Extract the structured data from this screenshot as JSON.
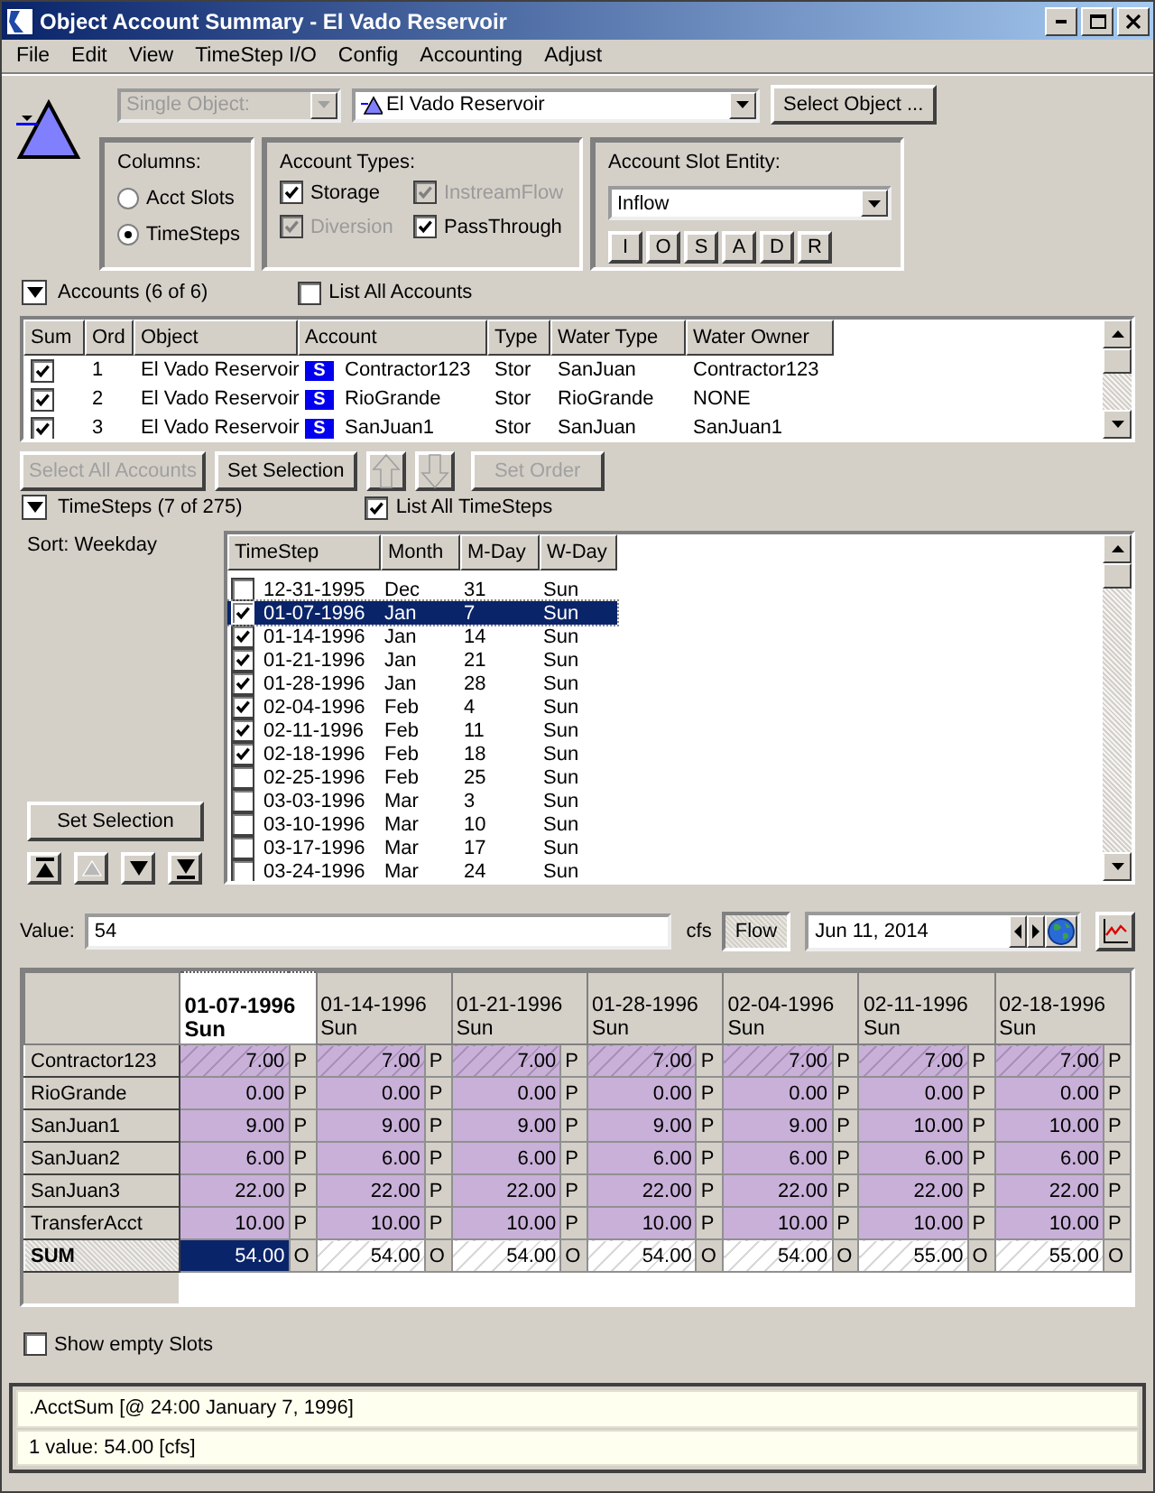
{
  "window": {
    "title": "Object Account Summary - El Vado Reservoir"
  },
  "menu": [
    "File",
    "Edit",
    "View",
    "TimeStep I/O",
    "Config",
    "Accounting",
    "Adjust"
  ],
  "object_bar": {
    "mode": {
      "value": "Single Object:",
      "disabled": true
    },
    "object": {
      "value": "El Vado Reservoir"
    },
    "select_button": "Select Object ..."
  },
  "columns_group": {
    "title": "Columns:",
    "options": [
      {
        "label": "Acct Slots",
        "selected": false
      },
      {
        "label": "TimeSteps",
        "selected": true
      }
    ]
  },
  "account_types": {
    "title": "Account Types:",
    "options": [
      {
        "label": "Storage",
        "checked": true,
        "disabled": false
      },
      {
        "label": "InstreamFlow",
        "checked": true,
        "disabled": true
      },
      {
        "label": "Diversion",
        "checked": true,
        "disabled": true
      },
      {
        "label": "PassThrough",
        "checked": true,
        "disabled": false
      }
    ]
  },
  "slot_entity": {
    "title": "Account Slot Entity:",
    "value": "Inflow",
    "buttons": [
      "I",
      "O",
      "S",
      "A",
      "D",
      "R"
    ]
  },
  "accounts": {
    "expanded": true,
    "title": "Accounts (6 of 6)",
    "list_all": {
      "label": "List All Accounts",
      "checked": false
    },
    "columns": [
      "Sum",
      "Ord",
      "Object",
      "Account",
      "Type",
      "Water Type",
      "Water Owner"
    ],
    "rows": [
      {
        "sum": true,
        "ord": "1",
        "object": "El Vado Reservoir",
        "badge": "S",
        "account": "Contractor123",
        "type": "Stor",
        "water_type": "SanJuan",
        "water_owner": "Contractor123"
      },
      {
        "sum": true,
        "ord": "2",
        "object": "El Vado Reservoir",
        "badge": "S",
        "account": "RioGrande",
        "type": "Stor",
        "water_type": "RioGrande",
        "water_owner": "NONE"
      },
      {
        "sum": true,
        "ord": "3",
        "object": "El Vado Reservoir",
        "badge": "S",
        "account": "SanJuan1",
        "type": "Stor",
        "water_type": "SanJuan",
        "water_owner": "SanJuan1"
      }
    ],
    "buttons": [
      {
        "kind": "text",
        "label": "Select All Accounts",
        "disabled": true
      },
      {
        "kind": "text",
        "label": "Set Selection",
        "disabled": false
      },
      {
        "kind": "up",
        "disabled": true
      },
      {
        "kind": "down",
        "disabled": true
      },
      {
        "kind": "text",
        "label": "Set Order",
        "disabled": true
      }
    ]
  },
  "timesteps": {
    "expanded": true,
    "title": "TimeSteps (7 of 275)",
    "list_all": {
      "label": "List All TimeSteps",
      "checked": true
    },
    "sort": "Sort: Weekday",
    "set_selection": "Set Selection",
    "nav_buttons": [
      {
        "kind": "first",
        "disabled": false
      },
      {
        "kind": "up",
        "disabled": true
      },
      {
        "kind": "down",
        "disabled": false
      },
      {
        "kind": "last",
        "disabled": false
      }
    ],
    "columns": [
      "TimeStep",
      "Month",
      "M-Day",
      "W-Day"
    ],
    "rows": [
      {
        "checked": false,
        "selected": false,
        "timestep": "12-31-1995",
        "month": "Dec",
        "mday": "31",
        "wday": "Sun"
      },
      {
        "checked": true,
        "selected": true,
        "timestep": "01-07-1996",
        "month": "Jan",
        "mday": "7",
        "wday": "Sun"
      },
      {
        "checked": true,
        "selected": false,
        "timestep": "01-14-1996",
        "month": "Jan",
        "mday": "14",
        "wday": "Sun"
      },
      {
        "checked": true,
        "selected": false,
        "timestep": "01-21-1996",
        "month": "Jan",
        "mday": "21",
        "wday": "Sun"
      },
      {
        "checked": true,
        "selected": false,
        "timestep": "01-28-1996",
        "month": "Jan",
        "mday": "28",
        "wday": "Sun"
      },
      {
        "checked": true,
        "selected": false,
        "timestep": "02-04-1996",
        "month": "Feb",
        "mday": "4",
        "wday": "Sun"
      },
      {
        "checked": true,
        "selected": false,
        "timestep": "02-11-1996",
        "month": "Feb",
        "mday": "11",
        "wday": "Sun"
      },
      {
        "checked": true,
        "selected": false,
        "timestep": "02-18-1996",
        "month": "Feb",
        "mday": "18",
        "wday": "Sun"
      },
      {
        "checked": false,
        "selected": false,
        "timestep": "02-25-1996",
        "month": "Feb",
        "mday": "25",
        "wday": "Sun"
      },
      {
        "checked": false,
        "selected": false,
        "timestep": "03-03-1996",
        "month": "Mar",
        "mday": "3",
        "wday": "Sun"
      },
      {
        "checked": false,
        "selected": false,
        "timestep": "03-10-1996",
        "month": "Mar",
        "mday": "10",
        "wday": "Sun"
      },
      {
        "checked": false,
        "selected": false,
        "timestep": "03-17-1996",
        "month": "Mar",
        "mday": "17",
        "wday": "Sun"
      },
      {
        "checked": false,
        "selected": false,
        "timestep": "03-24-1996",
        "month": "Mar",
        "mday": "24",
        "wday": "Sun"
      }
    ]
  },
  "value_bar": {
    "label": "Value:",
    "value": "54",
    "unit": "cfs",
    "flow_button": "Flow",
    "date": "Jun 11, 2014"
  },
  "grid": {
    "columns": [
      {
        "date": "01-07-1996",
        "day": "Sun",
        "selected": true
      },
      {
        "date": "01-14-1996",
        "day": "Sun",
        "selected": false
      },
      {
        "date": "01-21-1996",
        "day": "Sun",
        "selected": false
      },
      {
        "date": "01-28-1996",
        "day": "Sun",
        "selected": false
      },
      {
        "date": "02-04-1996",
        "day": "Sun",
        "selected": false
      },
      {
        "date": "02-11-1996",
        "day": "Sun",
        "selected": false
      },
      {
        "date": "02-18-1996",
        "day": "Sun",
        "selected": false
      }
    ],
    "rows": [
      {
        "kind": "account",
        "name": "Contractor123",
        "hatched": true,
        "cells": [
          {
            "value": "7.00",
            "flag": "P",
            "selected": false
          },
          {
            "value": "7.00",
            "flag": "P",
            "selected": false
          },
          {
            "value": "7.00",
            "flag": "P",
            "selected": false
          },
          {
            "value": "7.00",
            "flag": "P",
            "selected": false
          },
          {
            "value": "7.00",
            "flag": "P",
            "selected": false
          },
          {
            "value": "7.00",
            "flag": "P",
            "selected": false
          },
          {
            "value": "7.00",
            "flag": "P",
            "selected": false
          }
        ]
      },
      {
        "kind": "account",
        "name": "RioGrande",
        "hatched": false,
        "cells": [
          {
            "value": "0.00",
            "flag": "P",
            "selected": false
          },
          {
            "value": "0.00",
            "flag": "P",
            "selected": false
          },
          {
            "value": "0.00",
            "flag": "P",
            "selected": false
          },
          {
            "value": "0.00",
            "flag": "P",
            "selected": false
          },
          {
            "value": "0.00",
            "flag": "P",
            "selected": false
          },
          {
            "value": "0.00",
            "flag": "P",
            "selected": false
          },
          {
            "value": "0.00",
            "flag": "P",
            "selected": false
          }
        ]
      },
      {
        "kind": "account",
        "name": "SanJuan1",
        "hatched": false,
        "cells": [
          {
            "value": "9.00",
            "flag": "P",
            "selected": false
          },
          {
            "value": "9.00",
            "flag": "P",
            "selected": false
          },
          {
            "value": "9.00",
            "flag": "P",
            "selected": false
          },
          {
            "value": "9.00",
            "flag": "P",
            "selected": false
          },
          {
            "value": "9.00",
            "flag": "P",
            "selected": false
          },
          {
            "value": "10.00",
            "flag": "P",
            "selected": false
          },
          {
            "value": "10.00",
            "flag": "P",
            "selected": false
          }
        ]
      },
      {
        "kind": "account",
        "name": "SanJuan2",
        "hatched": false,
        "cells": [
          {
            "value": "6.00",
            "flag": "P",
            "selected": false
          },
          {
            "value": "6.00",
            "flag": "P",
            "selected": false
          },
          {
            "value": "6.00",
            "flag": "P",
            "selected": false
          },
          {
            "value": "6.00",
            "flag": "P",
            "selected": false
          },
          {
            "value": "6.00",
            "flag": "P",
            "selected": false
          },
          {
            "value": "6.00",
            "flag": "P",
            "selected": false
          },
          {
            "value": "6.00",
            "flag": "P",
            "selected": false
          }
        ]
      },
      {
        "kind": "account",
        "name": "SanJuan3",
        "hatched": false,
        "cells": [
          {
            "value": "22.00",
            "flag": "P",
            "selected": false
          },
          {
            "value": "22.00",
            "flag": "P",
            "selected": false
          },
          {
            "value": "22.00",
            "flag": "P",
            "selected": false
          },
          {
            "value": "22.00",
            "flag": "P",
            "selected": false
          },
          {
            "value": "22.00",
            "flag": "P",
            "selected": false
          },
          {
            "value": "22.00",
            "flag": "P",
            "selected": false
          },
          {
            "value": "22.00",
            "flag": "P",
            "selected": false
          }
        ]
      },
      {
        "kind": "account",
        "name": "TransferAcct",
        "hatched": false,
        "cells": [
          {
            "value": "10.00",
            "flag": "P",
            "selected": false
          },
          {
            "value": "10.00",
            "flag": "P",
            "selected": false
          },
          {
            "value": "10.00",
            "flag": "P",
            "selected": false
          },
          {
            "value": "10.00",
            "flag": "P",
            "selected": false
          },
          {
            "value": "10.00",
            "flag": "P",
            "selected": false
          },
          {
            "value": "10.00",
            "flag": "P",
            "selected": false
          },
          {
            "value": "10.00",
            "flag": "P",
            "selected": false
          }
        ]
      },
      {
        "kind": "sum",
        "name": "SUM",
        "hatched": true,
        "cells": [
          {
            "value": "54.00",
            "flag": "O",
            "selected": true
          },
          {
            "value": "54.00",
            "flag": "O",
            "selected": false
          },
          {
            "value": "54.00",
            "flag": "O",
            "selected": false
          },
          {
            "value": "54.00",
            "flag": "O",
            "selected": false
          },
          {
            "value": "54.00",
            "flag": "O",
            "selected": false
          },
          {
            "value": "55.00",
            "flag": "O",
            "selected": false
          },
          {
            "value": "55.00",
            "flag": "O",
            "selected": false
          }
        ]
      }
    ]
  },
  "show_empty": {
    "label": "Show empty Slots",
    "checked": false
  },
  "status": [
    ".AcctSum [@ 24:00 January 7, 1996]",
    "1 value:  54.00 [cfs]"
  ]
}
